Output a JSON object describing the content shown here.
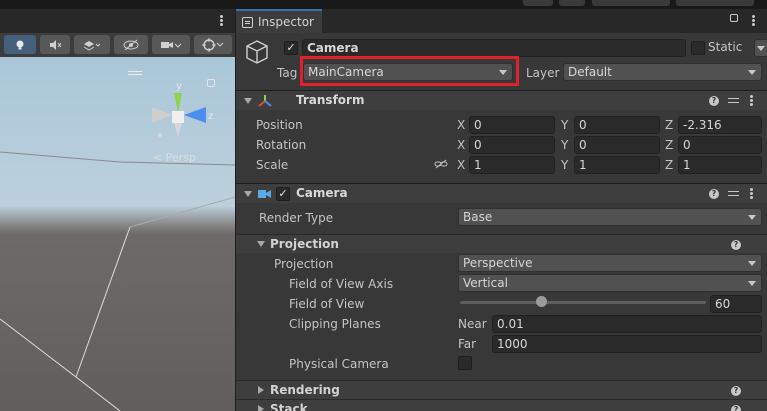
{
  "scene": {
    "persp_label": "Persp"
  },
  "inspector": {
    "tab_label": "Inspector",
    "object": {
      "name": "Camera",
      "static_label": "Static",
      "tag_label": "Tag",
      "tag_value": "MainCamera",
      "layer_label": "Layer",
      "layer_value": "Default"
    },
    "transform": {
      "title": "Transform",
      "position": {
        "label": "Position",
        "x": "0",
        "y": "0",
        "z": "-2.316"
      },
      "rotation": {
        "label": "Rotation",
        "x": "0",
        "y": "0",
        "z": "0"
      },
      "scale": {
        "label": "Scale",
        "x": "1",
        "y": "1",
        "z": "1"
      },
      "axis_x": "X",
      "axis_y": "Y",
      "axis_z": "Z"
    },
    "camera": {
      "title": "Camera",
      "render_type_label": "Render Type",
      "render_type_value": "Base",
      "projection_section": "Projection",
      "projection_label": "Projection",
      "projection_value": "Perspective",
      "fov_axis_label": "Field of View Axis",
      "fov_axis_value": "Vertical",
      "fov_label": "Field of View",
      "fov_value": "60",
      "fov_fraction": 0.33,
      "clipping_label": "Clipping Planes",
      "near_label": "Near",
      "near_value": "0.01",
      "far_label": "Far",
      "far_value": "1000",
      "physical_label": "Physical Camera",
      "rendering_section": "Rendering",
      "stack_section": "Stack"
    }
  },
  "colors": {
    "accent_blue": "#3a72b0",
    "highlight_red": "#e0202a"
  }
}
